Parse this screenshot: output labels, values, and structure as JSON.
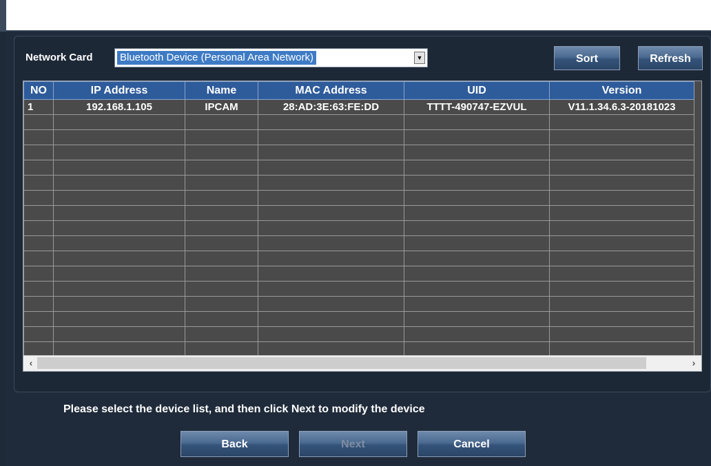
{
  "network_card": {
    "label": "Network Card",
    "selected": "Bluetooth Device (Personal Area Network)"
  },
  "buttons": {
    "sort": "Sort",
    "refresh": "Refresh",
    "back": "Back",
    "next": "Next",
    "cancel": "Cancel"
  },
  "table": {
    "headers": [
      "NO",
      "IP Address",
      "Name",
      "MAC Address",
      "UID",
      "Version"
    ],
    "rows": [
      [
        "1",
        "192.168.1.105",
        "IPCAM",
        "28:AD:3E:63:FE:DD",
        "TTTT-490747-EZVUL",
        "V11.1.34.6.3-20181023"
      ]
    ]
  },
  "hint": "Please select the device list, and then click Next to modify the device",
  "colors": {
    "header_bg": "#2e5b9a",
    "row_bg": "#4a4a4a",
    "button_gradient_top": "#6e8aac",
    "button_gradient_bottom": "#2a4567"
  },
  "icons": {
    "dropdown": "chevron-down-icon",
    "scroll_left": "chevron-left-icon",
    "scroll_right": "chevron-right-icon"
  }
}
